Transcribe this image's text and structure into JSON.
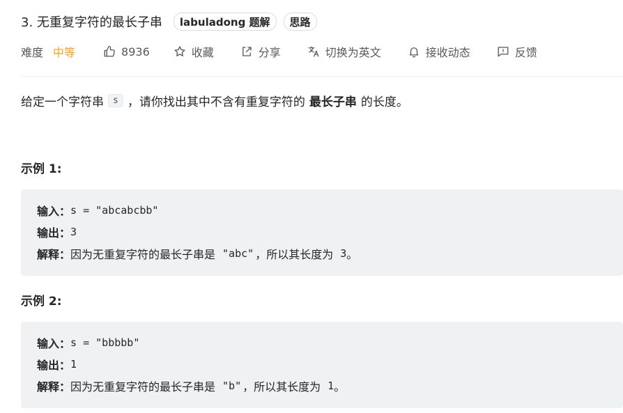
{
  "problem": {
    "title": "3. 无重复字符的最长子串",
    "tags": [
      "labuladong 题解",
      "思路"
    ]
  },
  "meta": {
    "difficulty_label": "难度",
    "difficulty_value": "中等",
    "difficulty_color": "#ffa116",
    "likes": "8936",
    "favorite": "收藏",
    "share": "分享",
    "switch_lang": "切换为英文",
    "notify": "接收动态",
    "feedback": "反馈",
    "icons": [
      "thumbs-up-icon",
      "star-icon",
      "share-icon",
      "translate-icon",
      "bell-icon",
      "feedback-icon"
    ]
  },
  "description": {
    "before": "给定一个字符串",
    "code": "s",
    "middle": "，请你找出其中不含有重复字符的",
    "bold": "最长子串",
    "after": "的长度。"
  },
  "examples": [
    {
      "heading": "示例 1:",
      "input_label": "输入：",
      "input_value": "s = \"abcabcbb\"",
      "output_label": "输出：",
      "output_value": "3",
      "explain_label": "解释：",
      "explain_text_1": "因为无重复字符的最长子串是",
      "explain_code": "\"abc\"",
      "explain_text_2": "，所以其长度为",
      "explain_num": "3",
      "explain_end": "。"
    },
    {
      "heading": "示例 2:",
      "input_label": "输入：",
      "input_value": "s = \"bbbbb\"",
      "output_label": "输出：",
      "output_value": "1",
      "explain_label": "解释：",
      "explain_text_1": "因为无重复字符的最长子串是",
      "explain_code": "\"b\"",
      "explain_text_2": "，所以其长度为",
      "explain_num": "1",
      "explain_end": "。"
    }
  ]
}
